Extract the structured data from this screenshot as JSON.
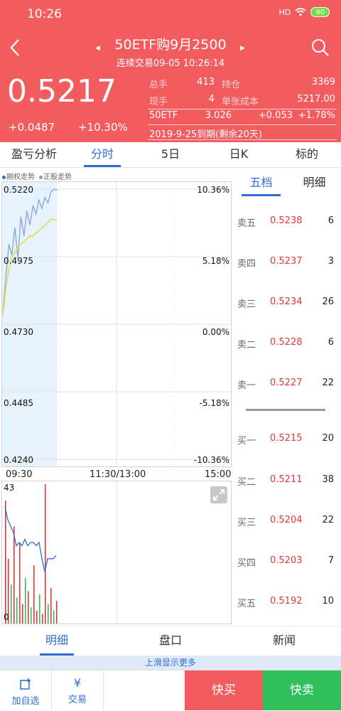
{
  "status": {
    "time": "10:26",
    "signal": "HD",
    "battery": "90"
  },
  "header": {
    "title": "50ETF购9月2500",
    "subtitle": "连续交易09-05  10:26:14",
    "price": "0.5217",
    "change": "+0.0487",
    "change_pct": "+10.30%",
    "stats": [
      {
        "l1": "总手",
        "v1": "413",
        "l2": "持仓",
        "v2": "3369"
      },
      {
        "l1": "现手",
        "v1": "4",
        "l2": "单张成本",
        "v2": "5217.00"
      }
    ],
    "underlying": {
      "name": "50ETF",
      "price": "3.026",
      "change": "+0.053",
      "pct": "+1.78%"
    },
    "expiry": "2019-9-25到期(剩余20天)"
  },
  "tabs": [
    "盈亏分析",
    "分时",
    "5日",
    "日K",
    "标的"
  ],
  "legend": {
    "option": "期权走势",
    "underlying": "正股走势"
  },
  "orderbook": {
    "tabs": [
      "五档",
      "明细"
    ],
    "asks": [
      {
        "name": "卖五",
        "price": "0.5238",
        "qty": "6"
      },
      {
        "name": "卖四",
        "price": "0.5237",
        "qty": "3"
      },
      {
        "name": "卖三",
        "price": "0.5234",
        "qty": "26"
      },
      {
        "name": "卖二",
        "price": "0.5228",
        "qty": "6"
      },
      {
        "name": "卖一",
        "price": "0.5227",
        "qty": "22"
      }
    ],
    "bids": [
      {
        "name": "买一",
        "price": "0.5215",
        "qty": "20"
      },
      {
        "name": "买二",
        "price": "0.5211",
        "qty": "38"
      },
      {
        "name": "买三",
        "price": "0.5204",
        "qty": "22"
      },
      {
        "name": "买四",
        "price": "0.5203",
        "qty": "7"
      },
      {
        "name": "买五",
        "price": "0.5192",
        "qty": "10"
      }
    ]
  },
  "bottom_tabs": [
    "明细",
    "盘口",
    "新闻"
  ],
  "more_hint": "上滑显示更多",
  "actions": {
    "add_watch": "加自选",
    "trade": "交易",
    "trade_icon": "¥",
    "quick_buy": "快买",
    "quick_sell": "快卖"
  },
  "colors": {
    "header": "#f25c5f",
    "accent": "#2f6fd0",
    "up": "#e8363b",
    "down": "#2fc05b"
  },
  "chart_data": {
    "type": "line",
    "y_left": [
      "0.5220",
      "0.4975",
      "0.4730",
      "0.4485",
      "0.4240"
    ],
    "y_right": [
      "10.36%",
      "5.18%",
      "0.00%",
      "-5.18%",
      "-10.36%"
    ],
    "ylim": [
      0.424,
      0.522
    ],
    "x_ticks": [
      "09:30",
      "11:30/13:00",
      "15:00"
    ],
    "session_minutes": 240,
    "series": [
      {
        "name": "期权走势",
        "color": "#8fa9d8",
        "values": [
          0.477,
          0.49,
          0.502,
          0.498,
          0.508,
          0.497,
          0.512,
          0.505,
          0.514,
          0.509,
          0.516,
          0.513,
          0.518,
          0.515,
          0.519,
          0.517,
          0.521,
          0.522,
          0.5217
        ]
      },
      {
        "name": "正股走势",
        "color": "#e8dc4a",
        "values": [
          0.476,
          0.486,
          0.493,
          0.497,
          0.499,
          0.501,
          0.502,
          0.503,
          0.504,
          0.505,
          0.505,
          0.506,
          0.507,
          0.508,
          0.509,
          0.51,
          0.511,
          0.511,
          0.511
        ]
      }
    ],
    "volume": {
      "max_label": "43",
      "min_label": "0",
      "max": 43,
      "bars": [
        {
          "v": 38,
          "c": "up"
        },
        {
          "v": 20,
          "c": "up"
        },
        {
          "v": 12,
          "c": "down"
        },
        {
          "v": 30,
          "c": "up"
        },
        {
          "v": 8,
          "c": "down"
        },
        {
          "v": 25,
          "c": "up"
        },
        {
          "v": 6,
          "c": "up"
        },
        {
          "v": 14,
          "c": "down"
        },
        {
          "v": 10,
          "c": "up"
        },
        {
          "v": 5,
          "c": "down"
        },
        {
          "v": 18,
          "c": "up"
        },
        {
          "v": 4,
          "c": "up"
        },
        {
          "v": 9,
          "c": "down"
        },
        {
          "v": 3,
          "c": "up"
        },
        {
          "v": 43,
          "c": "up"
        },
        {
          "v": 6,
          "c": "down"
        },
        {
          "v": 11,
          "c": "up"
        },
        {
          "v": 4,
          "c": "down"
        },
        {
          "v": 7,
          "c": "up"
        }
      ],
      "avg_line": [
        36,
        32,
        30,
        28,
        24,
        25,
        24,
        26,
        24,
        25,
        25,
        24,
        25,
        20,
        16,
        20,
        20,
        20,
        21
      ]
    }
  }
}
